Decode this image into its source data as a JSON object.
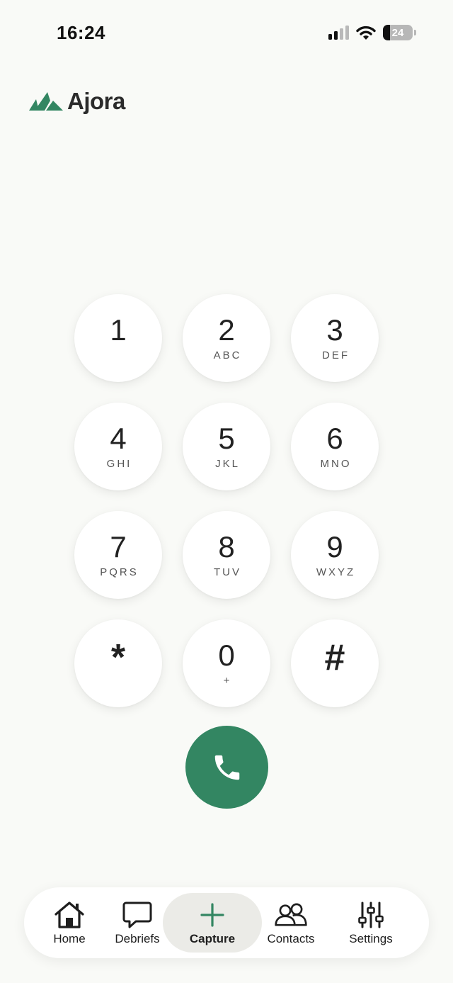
{
  "status_bar": {
    "time": "16:24",
    "battery_level": "24",
    "battery_fraction": 0.24,
    "signal_bars_active": 2,
    "signal_bars_total": 4,
    "icons": [
      "signal-icon",
      "wifi-icon",
      "battery-icon"
    ]
  },
  "brand": {
    "name": "Ajora",
    "logo_icon": "ajora-logo-icon",
    "color": "#338662"
  },
  "keypad": {
    "keys": [
      {
        "digit": "1",
        "letters": ""
      },
      {
        "digit": "2",
        "letters": "ABC"
      },
      {
        "digit": "3",
        "letters": "DEF"
      },
      {
        "digit": "4",
        "letters": "GHI"
      },
      {
        "digit": "5",
        "letters": "JKL"
      },
      {
        "digit": "6",
        "letters": "MNO"
      },
      {
        "digit": "7",
        "letters": "PQRS"
      },
      {
        "digit": "8",
        "letters": "TUV"
      },
      {
        "digit": "9",
        "letters": "WXYZ"
      },
      {
        "digit": "*",
        "letters": ""
      },
      {
        "digit": "0",
        "letters": "+"
      },
      {
        "digit": "#",
        "letters": ""
      }
    ]
  },
  "call_button": {
    "icon": "phone-icon",
    "color": "#338662"
  },
  "bottom_nav": {
    "items": [
      {
        "label": "Home",
        "icon": "home-icon",
        "active": false
      },
      {
        "label": "Debriefs",
        "icon": "chat-bubble-icon",
        "active": false
      },
      {
        "label": "Capture",
        "icon": "plus-icon",
        "active": true
      },
      {
        "label": "Contacts",
        "icon": "contacts-icon",
        "active": false
      },
      {
        "label": "Settings",
        "icon": "sliders-icon",
        "active": false
      }
    ],
    "active_color": "#338662"
  }
}
